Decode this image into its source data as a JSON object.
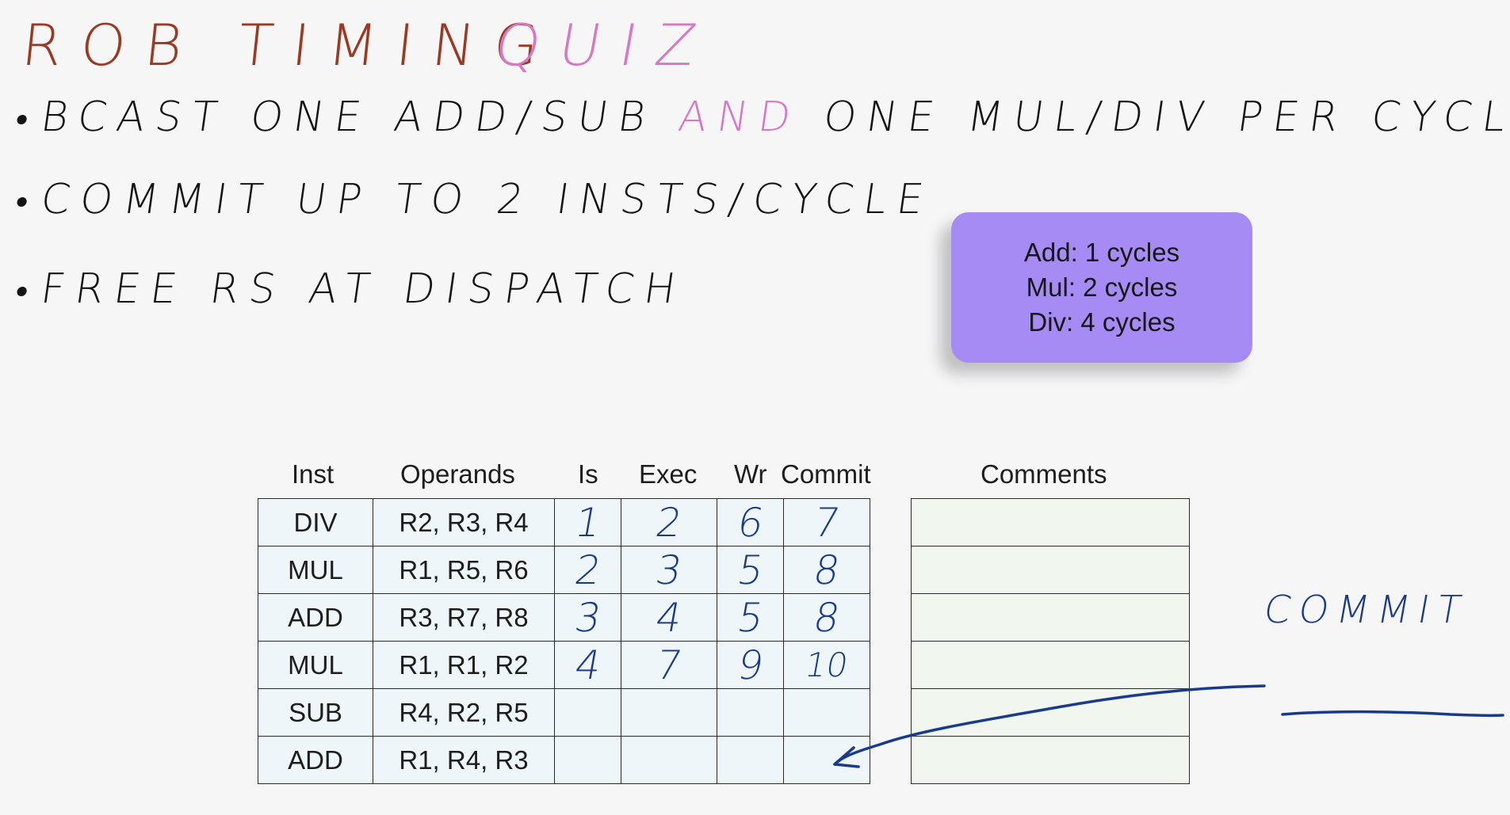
{
  "title": {
    "part1": "ROB TIMING",
    "part2": "QUIZ"
  },
  "bullets": [
    {
      "text_before": "BCAST ONE ADD/SUB",
      "highlight": "AND",
      "text_after": "ONE MUL/DIV PER CYCLE"
    },
    {
      "text": "COMMIT UP TO 2 INSTS/CYCLE"
    },
    {
      "text": "FREE RS AT DISPATCH"
    }
  ],
  "latency_box": {
    "lines": [
      "Add: 1 cycles",
      "Mul: 2 cycles",
      "Div: 4 cycles"
    ]
  },
  "table": {
    "headers": {
      "inst": "Inst",
      "operands": "Operands",
      "is": "Is",
      "exec": "Exec",
      "wr": "Wr",
      "commit": "Commit",
      "comments": "Comments"
    },
    "rows": [
      {
        "inst": "DIV",
        "operands": "R2, R3, R4",
        "is": "1",
        "exec": "2",
        "wr": "6",
        "commit": "7"
      },
      {
        "inst": "MUL",
        "operands": "R1, R5, R6",
        "is": "2",
        "exec": "3",
        "wr": "5",
        "commit": "8"
      },
      {
        "inst": "ADD",
        "operands": "R3, R7, R8",
        "is": "3",
        "exec": "4",
        "wr": "5",
        "commit": "8"
      },
      {
        "inst": "MUL",
        "operands": "R1, R1, R2",
        "is": "4",
        "exec": "7",
        "wr": "9",
        "commit": "10"
      },
      {
        "inst": "SUB",
        "operands": "R4, R2, R5",
        "is": "",
        "exec": "",
        "wr": "",
        "commit": ""
      },
      {
        "inst": "ADD",
        "operands": "R1, R4, R3",
        "is": "",
        "exec": "",
        "wr": "",
        "commit": ""
      }
    ]
  },
  "annotation": {
    "text": "COMMIT"
  },
  "colors": {
    "title": "#9a3a22",
    "accent_pink": "#d678c3",
    "ink_blue": "#1a3b8a",
    "box_purple": "#a78bf4"
  }
}
